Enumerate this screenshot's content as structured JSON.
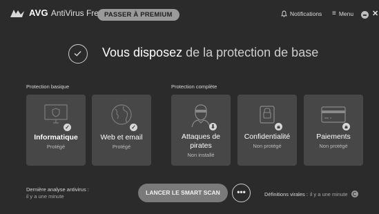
{
  "header": {
    "brand": "AVG",
    "product": "AntiVirus Free",
    "premium_label": "PASSER À PREMIUM",
    "notifications_label": "Notifications",
    "menu_label": "Menu"
  },
  "hero": {
    "title_strong": "Vous disposez",
    "title_light": " de la protection de base"
  },
  "sections": {
    "basic_label": "Protection basique",
    "full_label": "Protection complète"
  },
  "cards": [
    {
      "name": "Informatique",
      "status": "Protégé",
      "icon": "monitor-shield-icon",
      "badge": "check"
    },
    {
      "name": "Web et email",
      "status": "Protégé",
      "icon": "globe-icon",
      "badge": "check"
    },
    {
      "name": "Attaques de pirates",
      "name_line1": "Attaques de",
      "name_line2": "pirates",
      "status": "Non installé",
      "icon": "hacker-icon",
      "badge": "download"
    },
    {
      "name": "Confidentialité",
      "status": "Non protégé",
      "icon": "lock-icon",
      "badge": "lock"
    },
    {
      "name": "Paiements",
      "status": "Non protégé",
      "icon": "credit-card-icon",
      "badge": "lock"
    }
  ],
  "footer": {
    "last_scan_label": "Dernière analyse antivirus :",
    "last_scan_value": "il y a une minute",
    "scan_button": "LANCER LE SMART SCAN",
    "more_button": "•••",
    "definitions_label": "Définitions virales :",
    "definitions_value": "il y a une minute"
  },
  "colors": {
    "background": "#2b2b2b",
    "card": "#474747",
    "scan_button": "#7a7a7a",
    "premium_button": "#9a9a9a"
  }
}
